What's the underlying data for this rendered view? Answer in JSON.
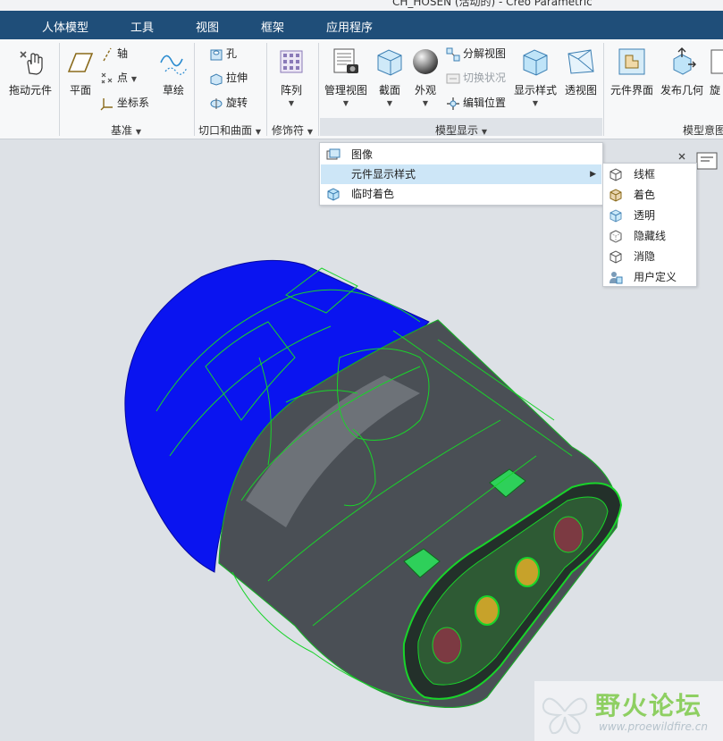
{
  "window": {
    "title": "CH_HOSEN (活动的) - Creo Parametric"
  },
  "menubar": {
    "tabs": [
      "人体模型",
      "工具",
      "视图",
      "框架",
      "应用程序"
    ]
  },
  "ribbon": {
    "drag_component": "拖动元件",
    "datum": {
      "plane": "平面",
      "axis": "轴",
      "point": "点",
      "csys": "坐标系",
      "sketch": "草绘",
      "group_label": "基准"
    },
    "cut_surface": {
      "hole": "孔",
      "extrude": "拉伸",
      "revolve": "旋转",
      "group_label": "切口和曲面"
    },
    "modifiers": {
      "pattern": "阵列",
      "group_label": "修饰符"
    },
    "model_display": {
      "manage_views": "管理视图",
      "section": "截面",
      "appearance": "外观",
      "explode_view": "分解视图",
      "toggle_status": "切换状况",
      "edit_position": "编辑位置",
      "display_style": "显示样式",
      "perspective": "透视图",
      "group_label": "模型显示"
    },
    "model_intent": {
      "component_interface": "元件界面",
      "publish_geometry": "发布几何",
      "rotate_partial": "旋",
      "group_label": "模型意图"
    }
  },
  "context_menu": {
    "items": [
      "图像",
      "元件显示样式",
      "临时着色"
    ],
    "highlighted": "元件显示样式"
  },
  "submenu": {
    "items": [
      "线框",
      "着色",
      "透明",
      "隐藏线",
      "消隐",
      "用户定义"
    ]
  },
  "watermark": {
    "title": "野火论坛",
    "url": "www.proewildfire.cn"
  },
  "colors": {
    "menubar_bg": "#1f4e79",
    "ribbon_bg": "#f7f8f9",
    "viewport_bg": "#dde1e6",
    "highlight": "#cde6f7",
    "model_blue": "#0a14f0",
    "model_dark": "#4a4f55",
    "edge_green": "#19d42a"
  }
}
